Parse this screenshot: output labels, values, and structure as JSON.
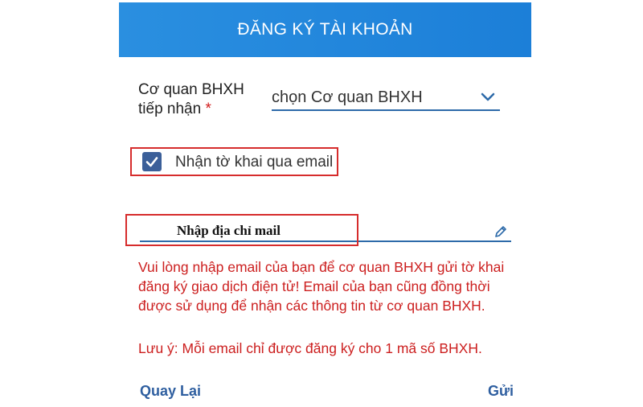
{
  "header": {
    "title": "ĐĂNG KÝ TÀI KHOẢN"
  },
  "agency_field": {
    "label_line1": "Cơ quan BHXH",
    "label_line2": "tiếp nhận",
    "required_mark": "*",
    "selected_value": "chọn Cơ quan BHXH",
    "icon": "chevron-down-icon"
  },
  "email_option": {
    "checked": true,
    "label": "Nhận tờ khai qua email",
    "icon": "checkmark-icon"
  },
  "email_field": {
    "placeholder": "Nhập địa chỉ mail",
    "value": "",
    "icon": "pencil-icon"
  },
  "notice": {
    "text": "Vui lòng nhập email của bạn để cơ quan BHXH gửi tờ khai đăng ký giao dịch điện tử! Email của bạn cũng đồng thời được sử dụng để nhận các thông tin từ cơ quan BHXH.",
    "note": "Lưu ý: Mỗi email chỉ được đăng ký cho 1 mã số BHXH."
  },
  "actions": {
    "back_label": "Quay Lại",
    "send_label": "Gửi"
  },
  "colors": {
    "header_bg": "#1c7fd8",
    "accent": "#2d6aa9",
    "checkbox": "#3b5f99",
    "highlight_frame": "#d62c2c",
    "notice_text": "#cc1f1f",
    "button_text": "#2f5fa0"
  }
}
